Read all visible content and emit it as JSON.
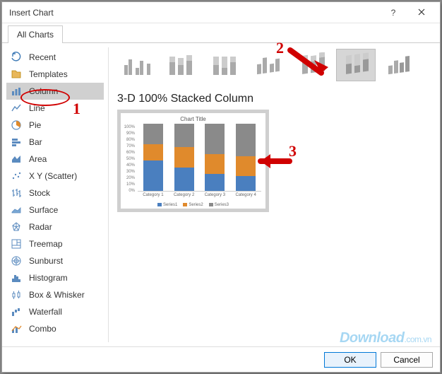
{
  "dialog": {
    "title": "Insert Chart"
  },
  "tabs": {
    "all_charts": "All Charts"
  },
  "sidebar": {
    "items": [
      {
        "label": "Recent"
      },
      {
        "label": "Templates"
      },
      {
        "label": "Column"
      },
      {
        "label": "Line"
      },
      {
        "label": "Pie"
      },
      {
        "label": "Bar"
      },
      {
        "label": "Area"
      },
      {
        "label": "X Y (Scatter)"
      },
      {
        "label": "Stock"
      },
      {
        "label": "Surface"
      },
      {
        "label": "Radar"
      },
      {
        "label": "Treemap"
      },
      {
        "label": "Sunburst"
      },
      {
        "label": "Histogram"
      },
      {
        "label": "Box & Whisker"
      },
      {
        "label": "Waterfall"
      },
      {
        "label": "Combo"
      }
    ],
    "selected_index": 2
  },
  "subtypes": {
    "names": [
      "clustered-column",
      "stacked-column",
      "100-stacked-column",
      "3d-clustered-column",
      "3d-stacked-column",
      "3d-100-stacked-column",
      "3d-column"
    ],
    "selected_index": 5,
    "selected_name": "3-D 100% Stacked Column"
  },
  "preview": {
    "title": "Chart Title",
    "y_ticks": [
      "100%",
      "90%",
      "80%",
      "70%",
      "60%",
      "50%",
      "40%",
      "30%",
      "20%",
      "10%",
      "0%"
    ],
    "legend": [
      "Series1",
      "Series2",
      "Series3"
    ]
  },
  "chart_data": {
    "type": "bar",
    "stacked": true,
    "percentage": true,
    "orientation": "vertical",
    "three_d": true,
    "title": "Chart Title",
    "xlabel": "",
    "ylabel": "",
    "ylim": [
      0,
      100
    ],
    "categories": [
      "Category 1",
      "Category 2",
      "Category 3",
      "Category 4"
    ],
    "series": [
      {
        "name": "Series1",
        "color": "#4a7fbf",
        "values": [
          45,
          35,
          25,
          22
        ]
      },
      {
        "name": "Series2",
        "color": "#e08a2c",
        "values": [
          25,
          30,
          30,
          30
        ]
      },
      {
        "name": "Series3",
        "color": "#8a8a8a",
        "values": [
          30,
          35,
          45,
          48
        ]
      }
    ]
  },
  "footer": {
    "ok": "OK",
    "cancel": "Cancel"
  },
  "annotations": {
    "n1": "1",
    "n2": "2",
    "n3": "3"
  },
  "watermark": {
    "main": "Download",
    "suffix": ".com.vn"
  }
}
